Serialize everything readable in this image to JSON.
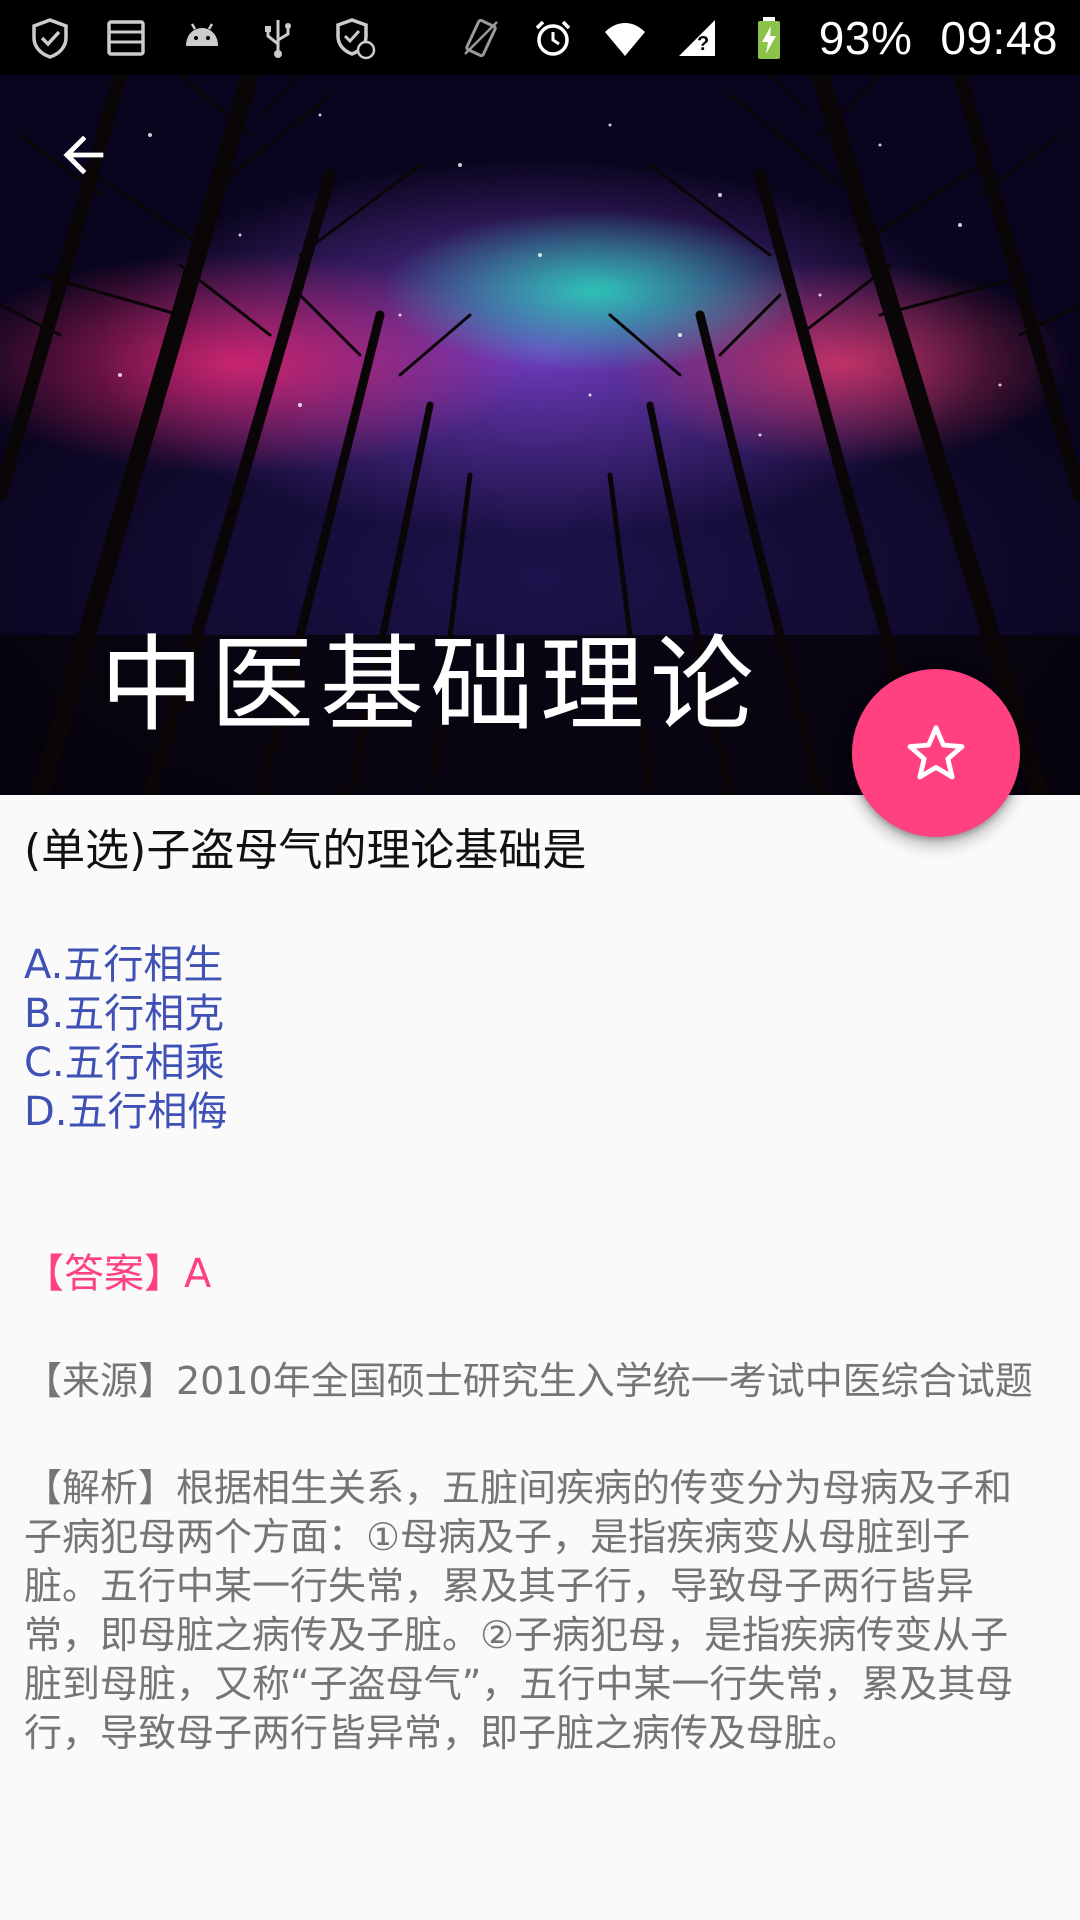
{
  "status_bar": {
    "left_icons": [
      "shield-check-icon",
      "storage-icon",
      "android-icon",
      "usb-icon",
      "shield-sync-icon"
    ],
    "right_icons": [
      "vibrate-icon",
      "alarm-icon",
      "wifi-icon",
      "signal-icon",
      "battery-charging-icon"
    ],
    "battery": "93%",
    "time": "09:48"
  },
  "header": {
    "back_icon": "arrow-back-icon",
    "title": "中医基础理论"
  },
  "fab": {
    "icon": "star-outline-icon"
  },
  "question": {
    "text": "(单选)子盗母气的理论基础是",
    "options": [
      "A.五行相生",
      "B.五行相克",
      "C.五行相乘",
      "D.五行相侮"
    ]
  },
  "answer": "【答案】A",
  "source": "【来源】2010年全国硕士研究生入学统一考试中医综合试题",
  "analysis": "【解析】根据相生关系，五脏间疾病的传变分为母病及子和子病犯母两个方面：①母病及子，是指疾病变从母脏到子脏。五行中某一行失常，累及其子行，导致母子两行皆异常，即母脏之病传及子脏。②子病犯母，是指疾病传变从子脏到母脏，又称“子盗母气”，五行中某一行失常，累及其母行，导致母子两行皆异常，即子脏之病传及母脏。",
  "colors": {
    "accent": "#ff4081",
    "option": "#3f51b5",
    "secondary_text": "#757575"
  }
}
